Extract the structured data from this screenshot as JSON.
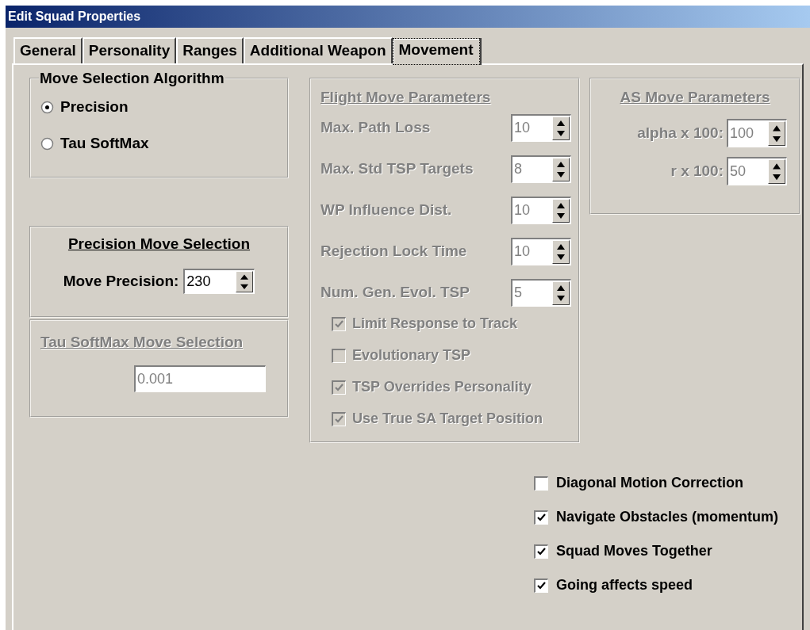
{
  "window": {
    "title": "Edit Squad Properties"
  },
  "tabs": [
    {
      "label": "General",
      "selected": false
    },
    {
      "label": "Personality",
      "selected": false
    },
    {
      "label": "Ranges",
      "selected": false
    },
    {
      "label": "Additional Weapon",
      "selected": false
    },
    {
      "label": "Movement",
      "selected": true
    }
  ],
  "move_selection_algorithm": {
    "title": "Move Selection Algorithm",
    "options": [
      {
        "label": "Precision",
        "selected": true
      },
      {
        "label": "Tau SoftMax",
        "selected": false
      }
    ]
  },
  "precision_move_selection": {
    "title": "Precision Move Selection",
    "disabled": false,
    "label": "Move Precision:",
    "value": "230"
  },
  "tau_softmax_move_selection": {
    "title": "Tau SoftMax Move Selection",
    "disabled": true,
    "value": "0.001"
  },
  "flight_move_parameters": {
    "title": "Flight Move Parameters",
    "disabled": true,
    "fields": [
      {
        "label": "Max. Path Loss",
        "value": "10"
      },
      {
        "label": "Max. Std TSP Targets",
        "value": "8"
      },
      {
        "label": "WP Influence Dist.",
        "value": "10"
      },
      {
        "label": "Rejection Lock Time",
        "value": "10"
      },
      {
        "label": "Num. Gen. Evol. TSP",
        "value": "5"
      }
    ],
    "checkboxes": [
      {
        "label": "Limit Response to Track",
        "checked": true
      },
      {
        "label": "Evolutionary TSP",
        "checked": false
      },
      {
        "label": "TSP Overrides Personality",
        "checked": true
      },
      {
        "label": "Use True SA Target Position",
        "checked": true
      }
    ]
  },
  "as_move_parameters": {
    "title": "AS Move Parameters",
    "disabled": true,
    "fields": [
      {
        "label": "alpha x 100:",
        "value": "100"
      },
      {
        "label": "r x 100:",
        "value": "50"
      }
    ]
  },
  "options": [
    {
      "label": "Diagonal Motion Correction",
      "checked": false
    },
    {
      "label": "Navigate Obstacles (momentum)",
      "checked": true
    },
    {
      "label": "Squad Moves Together",
      "checked": true
    },
    {
      "label": "Going affects speed",
      "checked": true
    }
  ]
}
